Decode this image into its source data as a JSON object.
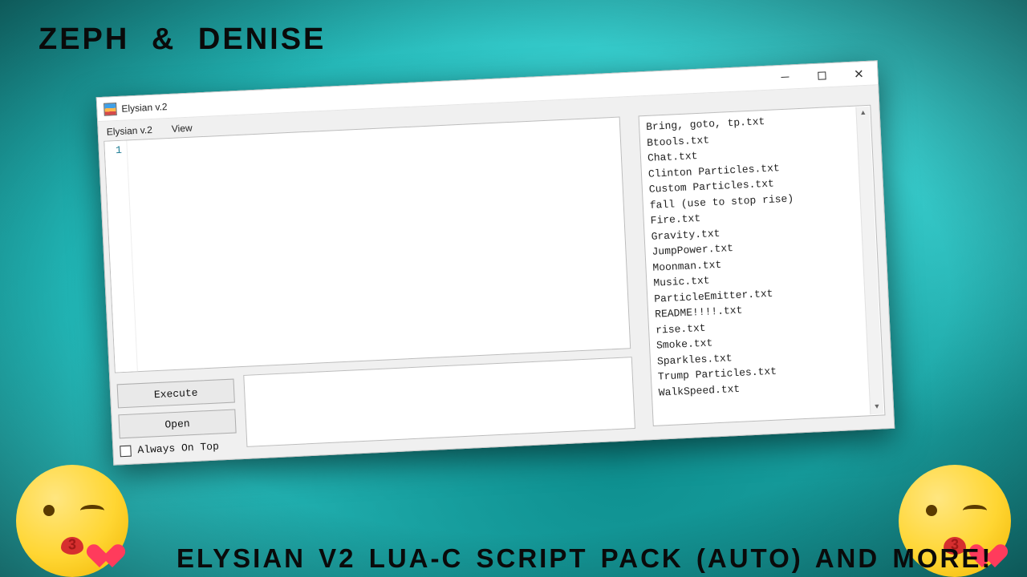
{
  "overlay": {
    "top": "ZEPH  &  DENISE",
    "bottom": "ELYSIAN V2 LUA-C SCRIPT PACK (AUTO) AND MORE!"
  },
  "window": {
    "title": "Elysian v.2"
  },
  "menubar": {
    "items": [
      "Elysian v.2",
      "View"
    ]
  },
  "editor": {
    "line_number": "1"
  },
  "buttons": {
    "execute": "Execute",
    "open": "Open"
  },
  "always_on_top": {
    "label": "Always On Top",
    "checked": false
  },
  "file_list": [
    "Bring, goto, tp.txt",
    "Btools.txt",
    "Chat.txt",
    "Clinton Particles.txt",
    "Custom Particles.txt",
    "fall (use to stop rise)",
    "Fire.txt",
    "Gravity.txt",
    "JumpPower.txt",
    "Moonman.txt",
    "Music.txt",
    "ParticleEmitter.txt",
    "README!!!!.txt",
    "rise.txt",
    "Smoke.txt",
    "Sparkles.txt",
    "Trump Particles.txt",
    "WalkSpeed.txt"
  ]
}
